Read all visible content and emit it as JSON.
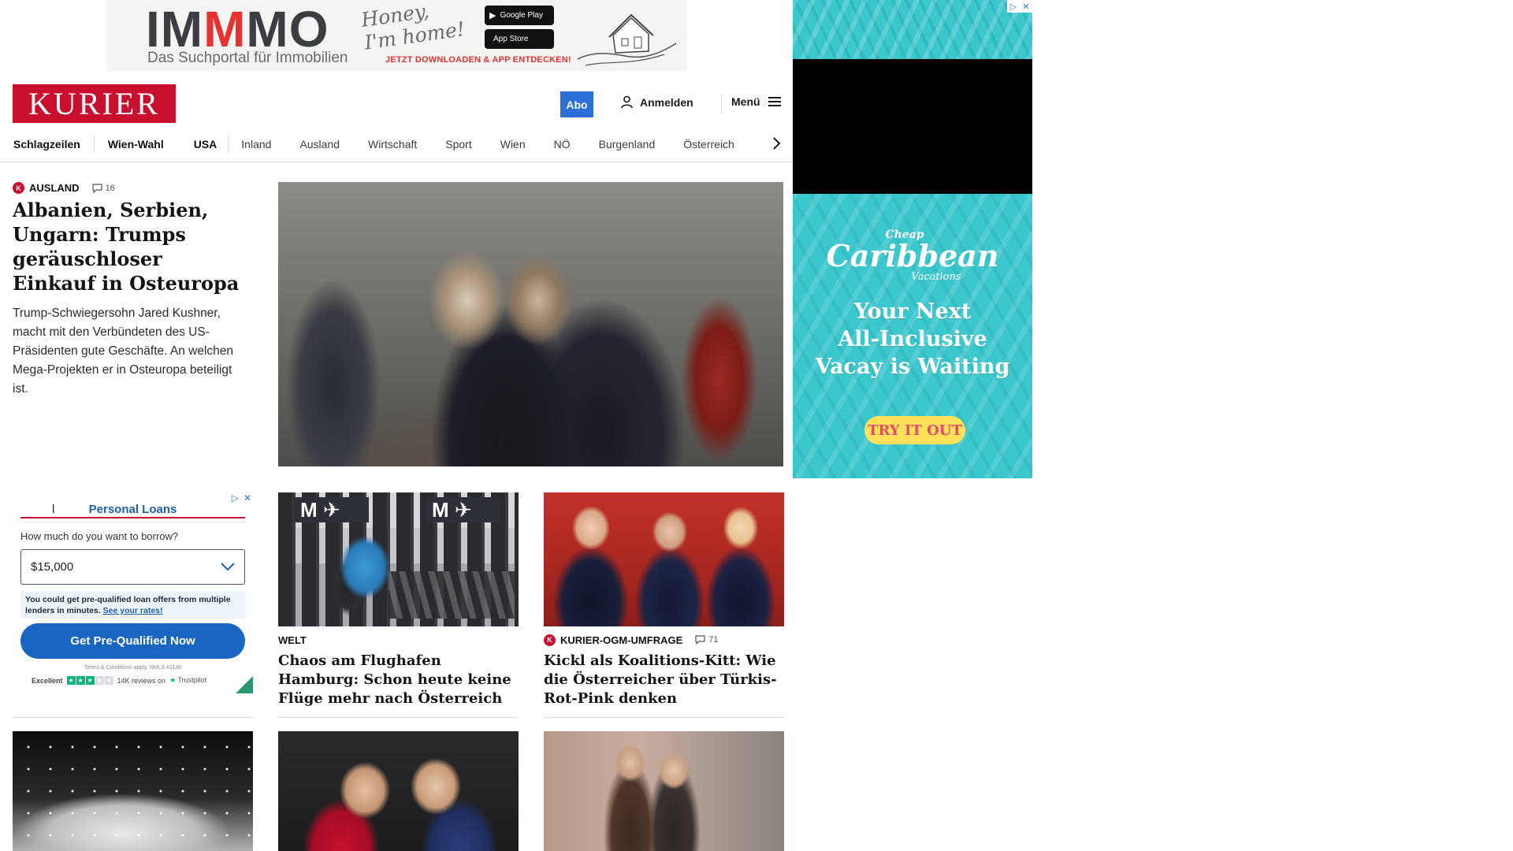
{
  "top_ad": {
    "logo_part1": "IM",
    "logo_part2": "M",
    "logo_part3": "MO",
    "tagline": "Das Suchportal für Immobilien",
    "script_line1": "Honey,",
    "script_line2": "I'm home!",
    "google_play": "Google Play",
    "app_store": "App Store",
    "cta": "JETZT DOWNLOADEN & APP ENTDECKEN!",
    "brand_color": "#e63331"
  },
  "header": {
    "logo": "KURIER",
    "logo_color": "#c8102e",
    "abo": "Abo",
    "abo_color": "#2c6fd6",
    "login": "Anmelden",
    "menu": "Menü"
  },
  "nav": {
    "items": [
      {
        "label": "Schlagzeilen",
        "bold": true
      },
      {
        "label": "Wien-Wahl",
        "bold": true
      },
      {
        "label": "USA",
        "bold": true
      },
      {
        "label": "Inland",
        "bold": false
      },
      {
        "label": "Ausland",
        "bold": false
      },
      {
        "label": "Wirtschaft",
        "bold": false
      },
      {
        "label": "Sport",
        "bold": false
      },
      {
        "label": "Wien",
        "bold": false
      },
      {
        "label": "NÖ",
        "bold": false
      },
      {
        "label": "Burgenland",
        "bold": false
      },
      {
        "label": "Österreich",
        "bold": false
      }
    ]
  },
  "lead": {
    "badge": "K",
    "section": "AUSLAND",
    "comments": "16",
    "title": "Albanien, Serbien, Ungarn: Trumps geräuschloser Einkauf in Osteuropa",
    "teaser": "Trump-Schwiegersohn Jared Kushner, macht mit den Verbündeten des US-Präsidenten gute Geschäfte. An welchen Mega-Projekten er in Osteuropa beteiligt ist."
  },
  "loan_ad": {
    "cursor": "l",
    "heading": "Personal Loans",
    "question": "How much do you want to borrow?",
    "amount": "$15,000",
    "note": "You could get pre-qualified loan offers from multiple lenders in minutes.",
    "note_link": "See your rates!",
    "button": "Get Pre-Qualified Now",
    "terms": "Terms & Conditions apply. NMLS #1136",
    "rating_word": "Excellent",
    "reviews": "14K reviews on",
    "trustpilot": "Trustpilot"
  },
  "cards": [
    {
      "kicker": "WELT",
      "title": "Chaos am Flughafen Hamburg: Schon heute keine Flüge mehr nach Österreich"
    },
    {
      "badge": "K",
      "kicker": "KURIER-OGM-UMFRAGE",
      "comments": "71",
      "title": "Kickl als Koalitions-Kitt: Wie die Österreicher über Türkis-Rot-Pink denken"
    }
  ],
  "side_ad": {
    "cheap": "Cheap",
    "caribbean": "Caribbean",
    "vacations": "Vacations",
    "headline_1": "Your Next",
    "headline_2": "All-Inclusive",
    "headline_3": "Vacay is Waiting",
    "button": "TRY IT OUT",
    "bg_color": "#3cc7cd"
  }
}
